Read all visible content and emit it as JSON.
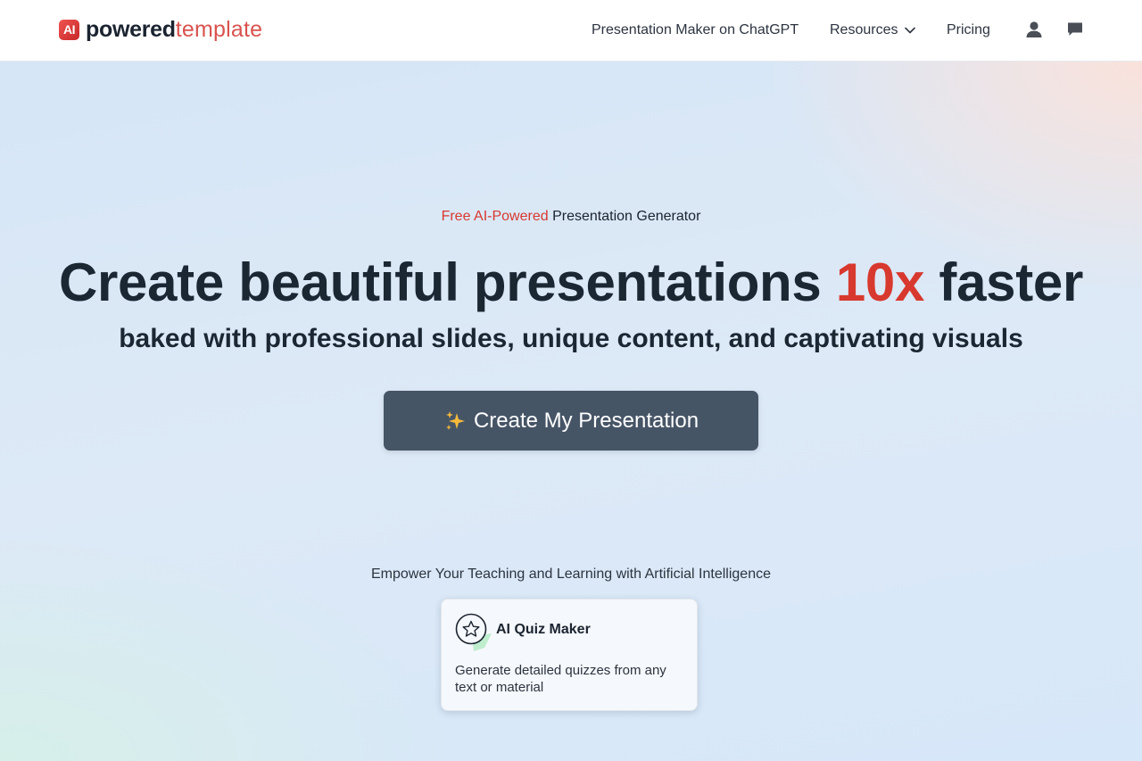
{
  "header": {
    "logo": {
      "badge": "AI",
      "word_bold": "powered",
      "word_light": "template"
    },
    "nav": {
      "chatgpt_label": "Presentation Maker on ChatGPT",
      "resources_label": "Resources",
      "pricing_label": "Pricing"
    },
    "icons": {
      "user": "user-icon",
      "chat": "chat-icon",
      "chevron": "chevron-down-icon"
    }
  },
  "hero": {
    "tagline_accent": "Free AI-Powered",
    "tagline_rest": " Presentation Generator",
    "headline_before": "Create beautiful presentations ",
    "headline_accent": "10x",
    "headline_after": " faster",
    "subheadline": "baked with professional slides, unique content, and captivating visuals",
    "cta_label": "Create My Presentation",
    "cta_icon": "sparkles-icon"
  },
  "tools": {
    "heading": "Empower Your Teaching and Learning with Artificial Intelligence",
    "cards": [
      {
        "title": "AI Quiz Maker",
        "description": "Generate detailed quizzes from any text or material",
        "icon": "star-badge-icon"
      }
    ]
  },
  "colors": {
    "accent": "#d8392f",
    "button": "#465566",
    "text": "#1b2733"
  }
}
